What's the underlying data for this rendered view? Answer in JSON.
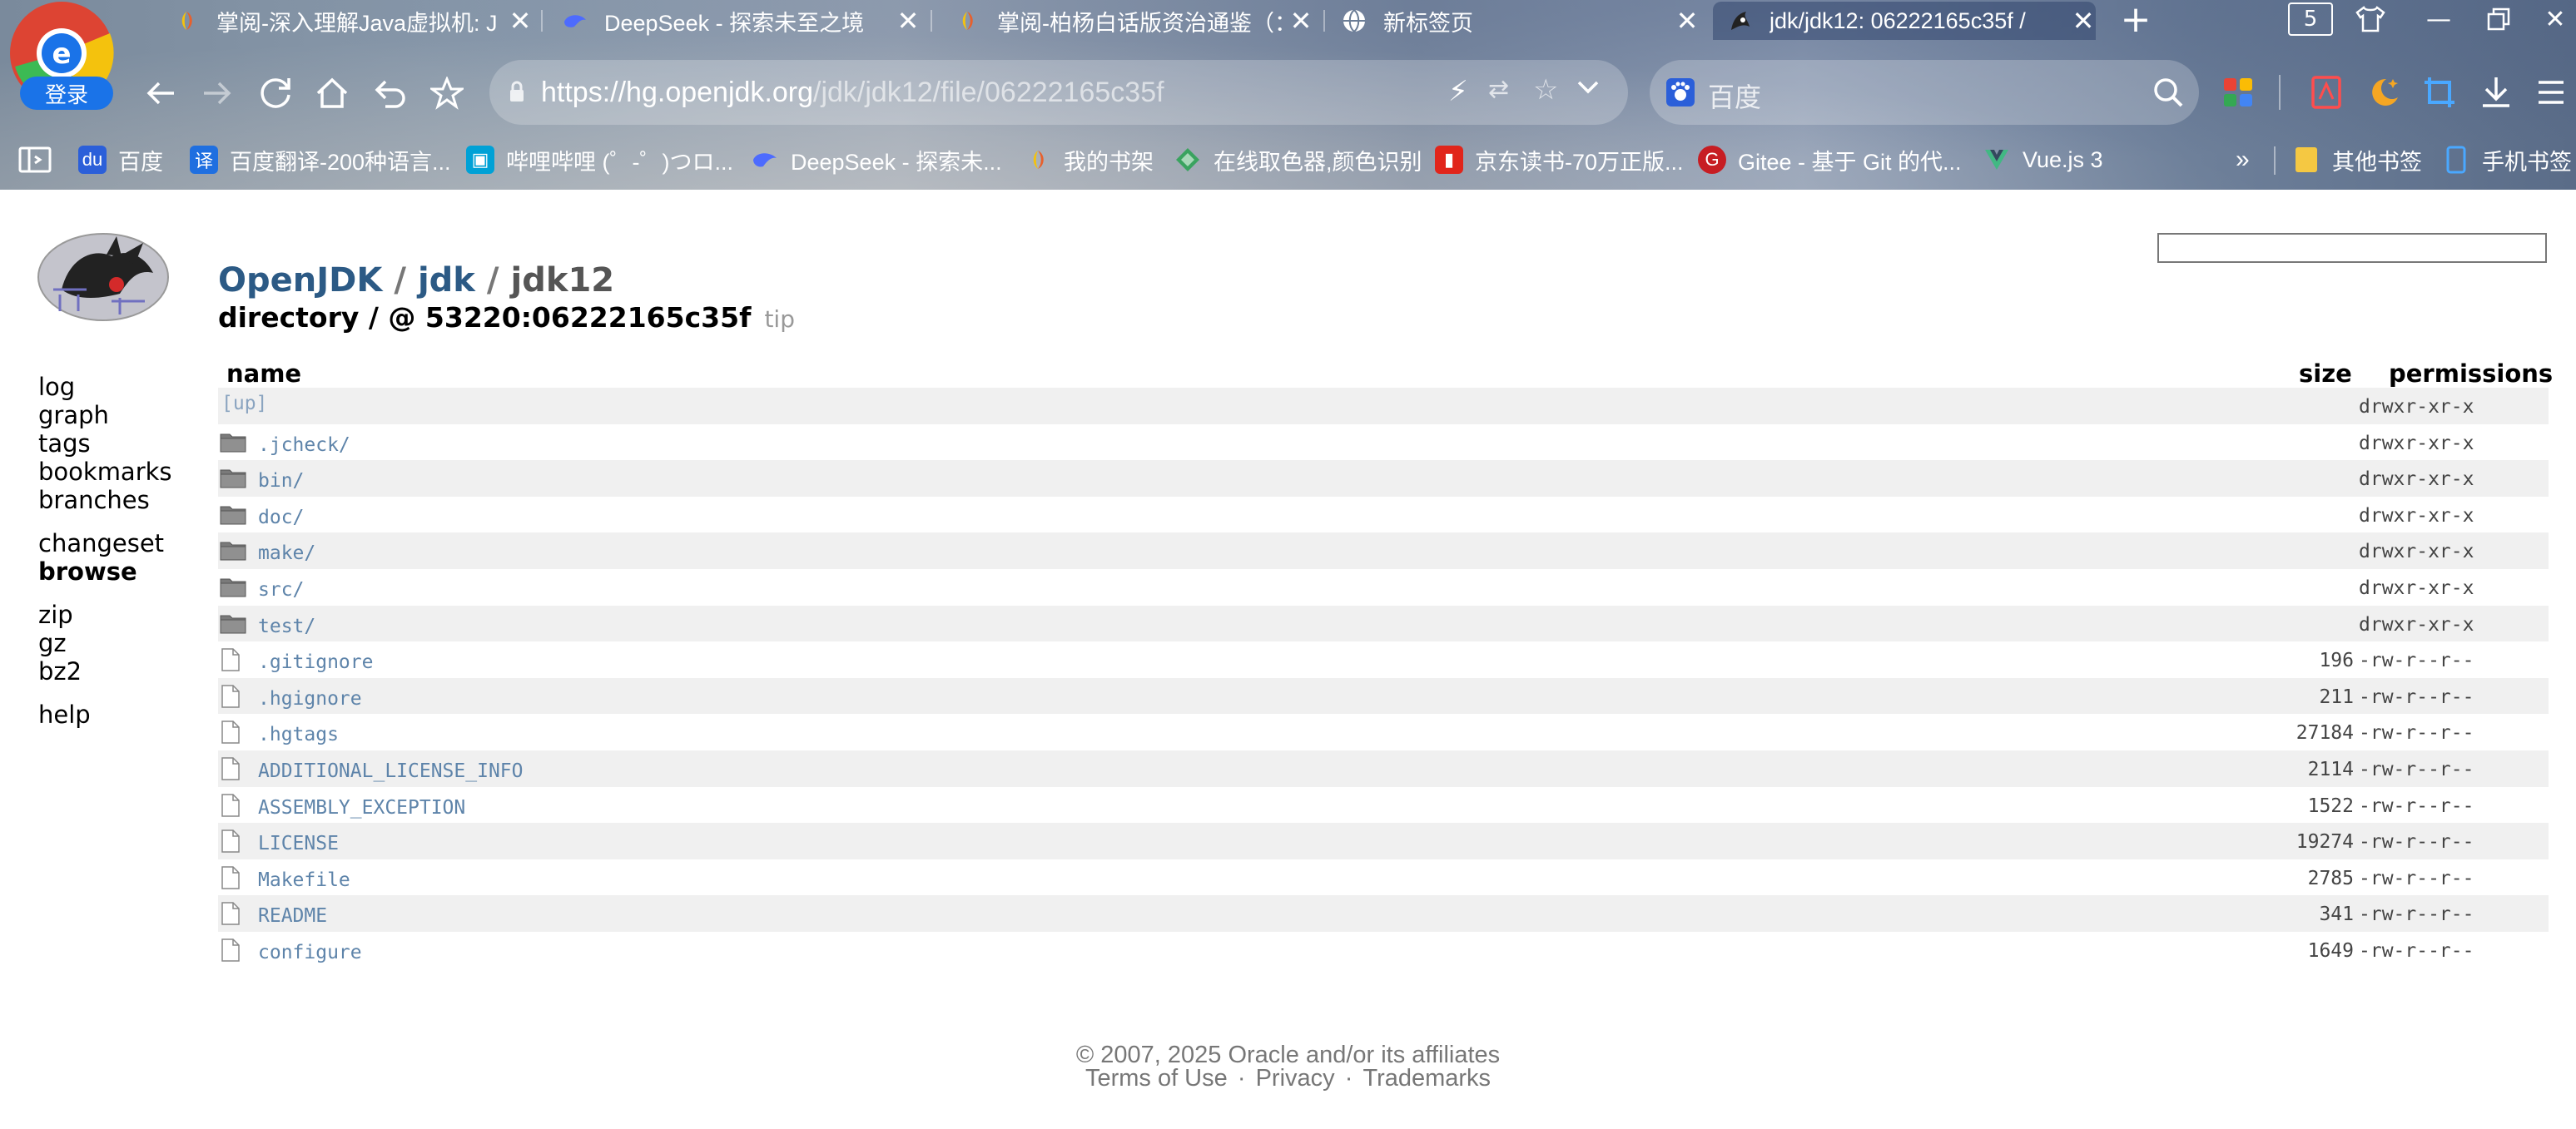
{
  "browser": {
    "login_label": "登录",
    "tab_count": "5",
    "tabs": [
      {
        "title": "掌阅-深入理解Java虚拟机: J",
        "icon": "zhangyue-icon"
      },
      {
        "title": "DeepSeek - 探索未至之境",
        "icon": "deepseek-icon"
      },
      {
        "title": "掌阅-柏杨白话版资治通鉴（：",
        "icon": "zhangyue-icon"
      },
      {
        "title": "新标签页",
        "icon": "globe-icon"
      },
      {
        "title": "jdk/jdk12: 06222165c35f /",
        "icon": "mercurial-icon"
      }
    ],
    "url_host": "https://hg.openjdk.org",
    "url_path": "/jdk/jdk12/file/06222165c35f",
    "search_placeholder": "百度",
    "bookmarks": [
      {
        "label": "百度",
        "color": "#2b5fd9"
      },
      {
        "label": "百度翻译-200种语言...",
        "color": "#1f6fe0"
      },
      {
        "label": "哔哩哔哩 (゜-゜)つロ...",
        "color": "#00a1d6"
      },
      {
        "label": "DeepSeek - 探索未...",
        "color": "#4d6bfe"
      },
      {
        "label": "我的书架",
        "color": "#e8602c"
      },
      {
        "label": "在线取色器,颜色识别",
        "color": "#3aa35f"
      },
      {
        "label": "京东读书-70万正版...",
        "color": "#e1251b"
      },
      {
        "label": "Gitee - 基于 Git 的代...",
        "color": "#c71d23"
      },
      {
        "label": "Vue.js 3",
        "color": "#41b883"
      }
    ],
    "bookmarks_more": "»",
    "other_bookmarks": "其他书签",
    "mobile_bookmarks": "手机书签"
  },
  "page": {
    "breadcrumb": {
      "root": "OpenJDK",
      "sep": "/",
      "mid": "jdk",
      "last": "jdk12"
    },
    "directory_title": "directory / @ 53220:06222165c35f",
    "tip_tag": "tip",
    "sidebar": {
      "log": "log",
      "graph": "graph",
      "tags": "tags",
      "bookmarks": "bookmarks",
      "branches": "branches",
      "changeset": "changeset",
      "browse": "browse",
      "zip": "zip",
      "gz": "gz",
      "bz2": "bz2",
      "help": "help"
    },
    "headers": {
      "name": "name",
      "size": "size",
      "permissions": "permissions"
    },
    "up": "[up]",
    "up_perm": "drwxr-xr-x",
    "files": [
      {
        "name": ".jcheck/",
        "type": "dir",
        "size": "",
        "perm": "drwxr-xr-x"
      },
      {
        "name": "bin/",
        "type": "dir",
        "size": "",
        "perm": "drwxr-xr-x"
      },
      {
        "name": "doc/",
        "type": "dir",
        "size": "",
        "perm": "drwxr-xr-x"
      },
      {
        "name": "make/",
        "type": "dir",
        "size": "",
        "perm": "drwxr-xr-x"
      },
      {
        "name": "src/",
        "type": "dir",
        "size": "",
        "perm": "drwxr-xr-x"
      },
      {
        "name": "test/",
        "type": "dir",
        "size": "",
        "perm": "drwxr-xr-x"
      },
      {
        "name": ".gitignore",
        "type": "file",
        "size": "196",
        "perm": "-rw-r--r--"
      },
      {
        "name": ".hgignore",
        "type": "file",
        "size": "211",
        "perm": "-rw-r--r--"
      },
      {
        "name": ".hgtags",
        "type": "file",
        "size": "27184",
        "perm": "-rw-r--r--"
      },
      {
        "name": "ADDITIONAL_LICENSE_INFO",
        "type": "file",
        "size": "2114",
        "perm": "-rw-r--r--"
      },
      {
        "name": "ASSEMBLY_EXCEPTION",
        "type": "file",
        "size": "1522",
        "perm": "-rw-r--r--"
      },
      {
        "name": "LICENSE",
        "type": "file",
        "size": "19274",
        "perm": "-rw-r--r--"
      },
      {
        "name": "Makefile",
        "type": "file",
        "size": "2785",
        "perm": "-rw-r--r--"
      },
      {
        "name": "README",
        "type": "file",
        "size": "341",
        "perm": "-rw-r--r--"
      },
      {
        "name": "configure",
        "type": "file",
        "size": "1649",
        "perm": "-rw-r--r--"
      }
    ],
    "footer": {
      "copyright": "© 2007, 2025 Oracle and/or its affiliates",
      "terms": "Terms of Use",
      "dot": "·",
      "privacy": "Privacy",
      "trademarks": "Trademarks"
    }
  }
}
